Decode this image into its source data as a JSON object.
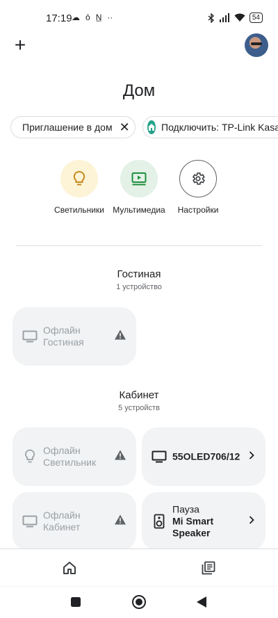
{
  "status_bar": {
    "time": "17:19",
    "left_glyphs": [
      "☁",
      "ō",
      "N̲",
      "··"
    ],
    "battery": "54"
  },
  "header": {
    "add_label": "+",
    "title": "Дом"
  },
  "chips": {
    "invite_label": "Приглашение в дом",
    "invite_close": "✕",
    "connect_label": "Подключить: TP-Link Kasa"
  },
  "quick_actions": {
    "lights": "Светильники",
    "media": "Мультимедиа",
    "settings": "Настройки"
  },
  "rooms": {
    "living": {
      "name": "Гостиная",
      "count": "1 устройство",
      "devices": [
        {
          "status": "Офлайн",
          "name": "Гостиная",
          "icon": "tv-icon"
        }
      ]
    },
    "office": {
      "name": "Кабинет",
      "count": "5 устройств",
      "devices": [
        {
          "status": "Офлайн",
          "name": "Светильник",
          "icon": "bulb-icon"
        },
        {
          "name": "55OLED706/12",
          "icon": "tv-icon"
        },
        {
          "status": "Офлайн",
          "name": "Кабинет",
          "icon": "tv-icon"
        },
        {
          "status": "Пауза",
          "name_line1": "Mi Smart",
          "name_line2": "Speaker",
          "icon": "speaker-icon"
        }
      ]
    }
  },
  "colors": {
    "tile_bg": "#f1f3f4",
    "lights_bg": "#fdf3d6",
    "media_bg": "#e3f1e6",
    "accent_home": "#23a28a"
  }
}
